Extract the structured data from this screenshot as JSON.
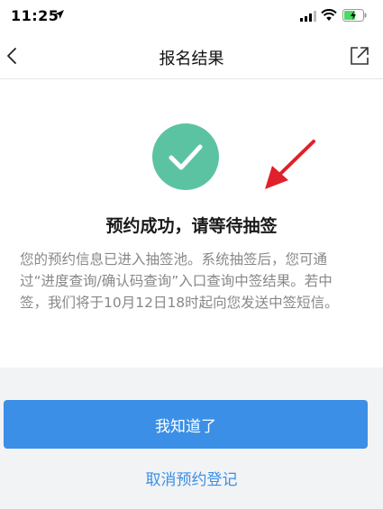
{
  "status_bar": {
    "time": "11:25"
  },
  "nav": {
    "title": "报名结果",
    "back_icon": "chevron-left-icon",
    "share_icon": "share-external-icon"
  },
  "result": {
    "icon": "check-circle-icon",
    "title": "预约成功，请等待抽签",
    "description": "您的预约信息已进入抽签池。系统抽签后，您可通过“进度查询/确认码查询”入口查询中签结果。若中签，我们将于10月12日18时起向您发送中签短信。"
  },
  "actions": {
    "confirm_label": "我知道了",
    "cancel_label": "取消预约登记"
  },
  "colors": {
    "accent": "#3b8fe6",
    "success": "#5cc3a2",
    "annotation_arrow": "#e0202a"
  }
}
